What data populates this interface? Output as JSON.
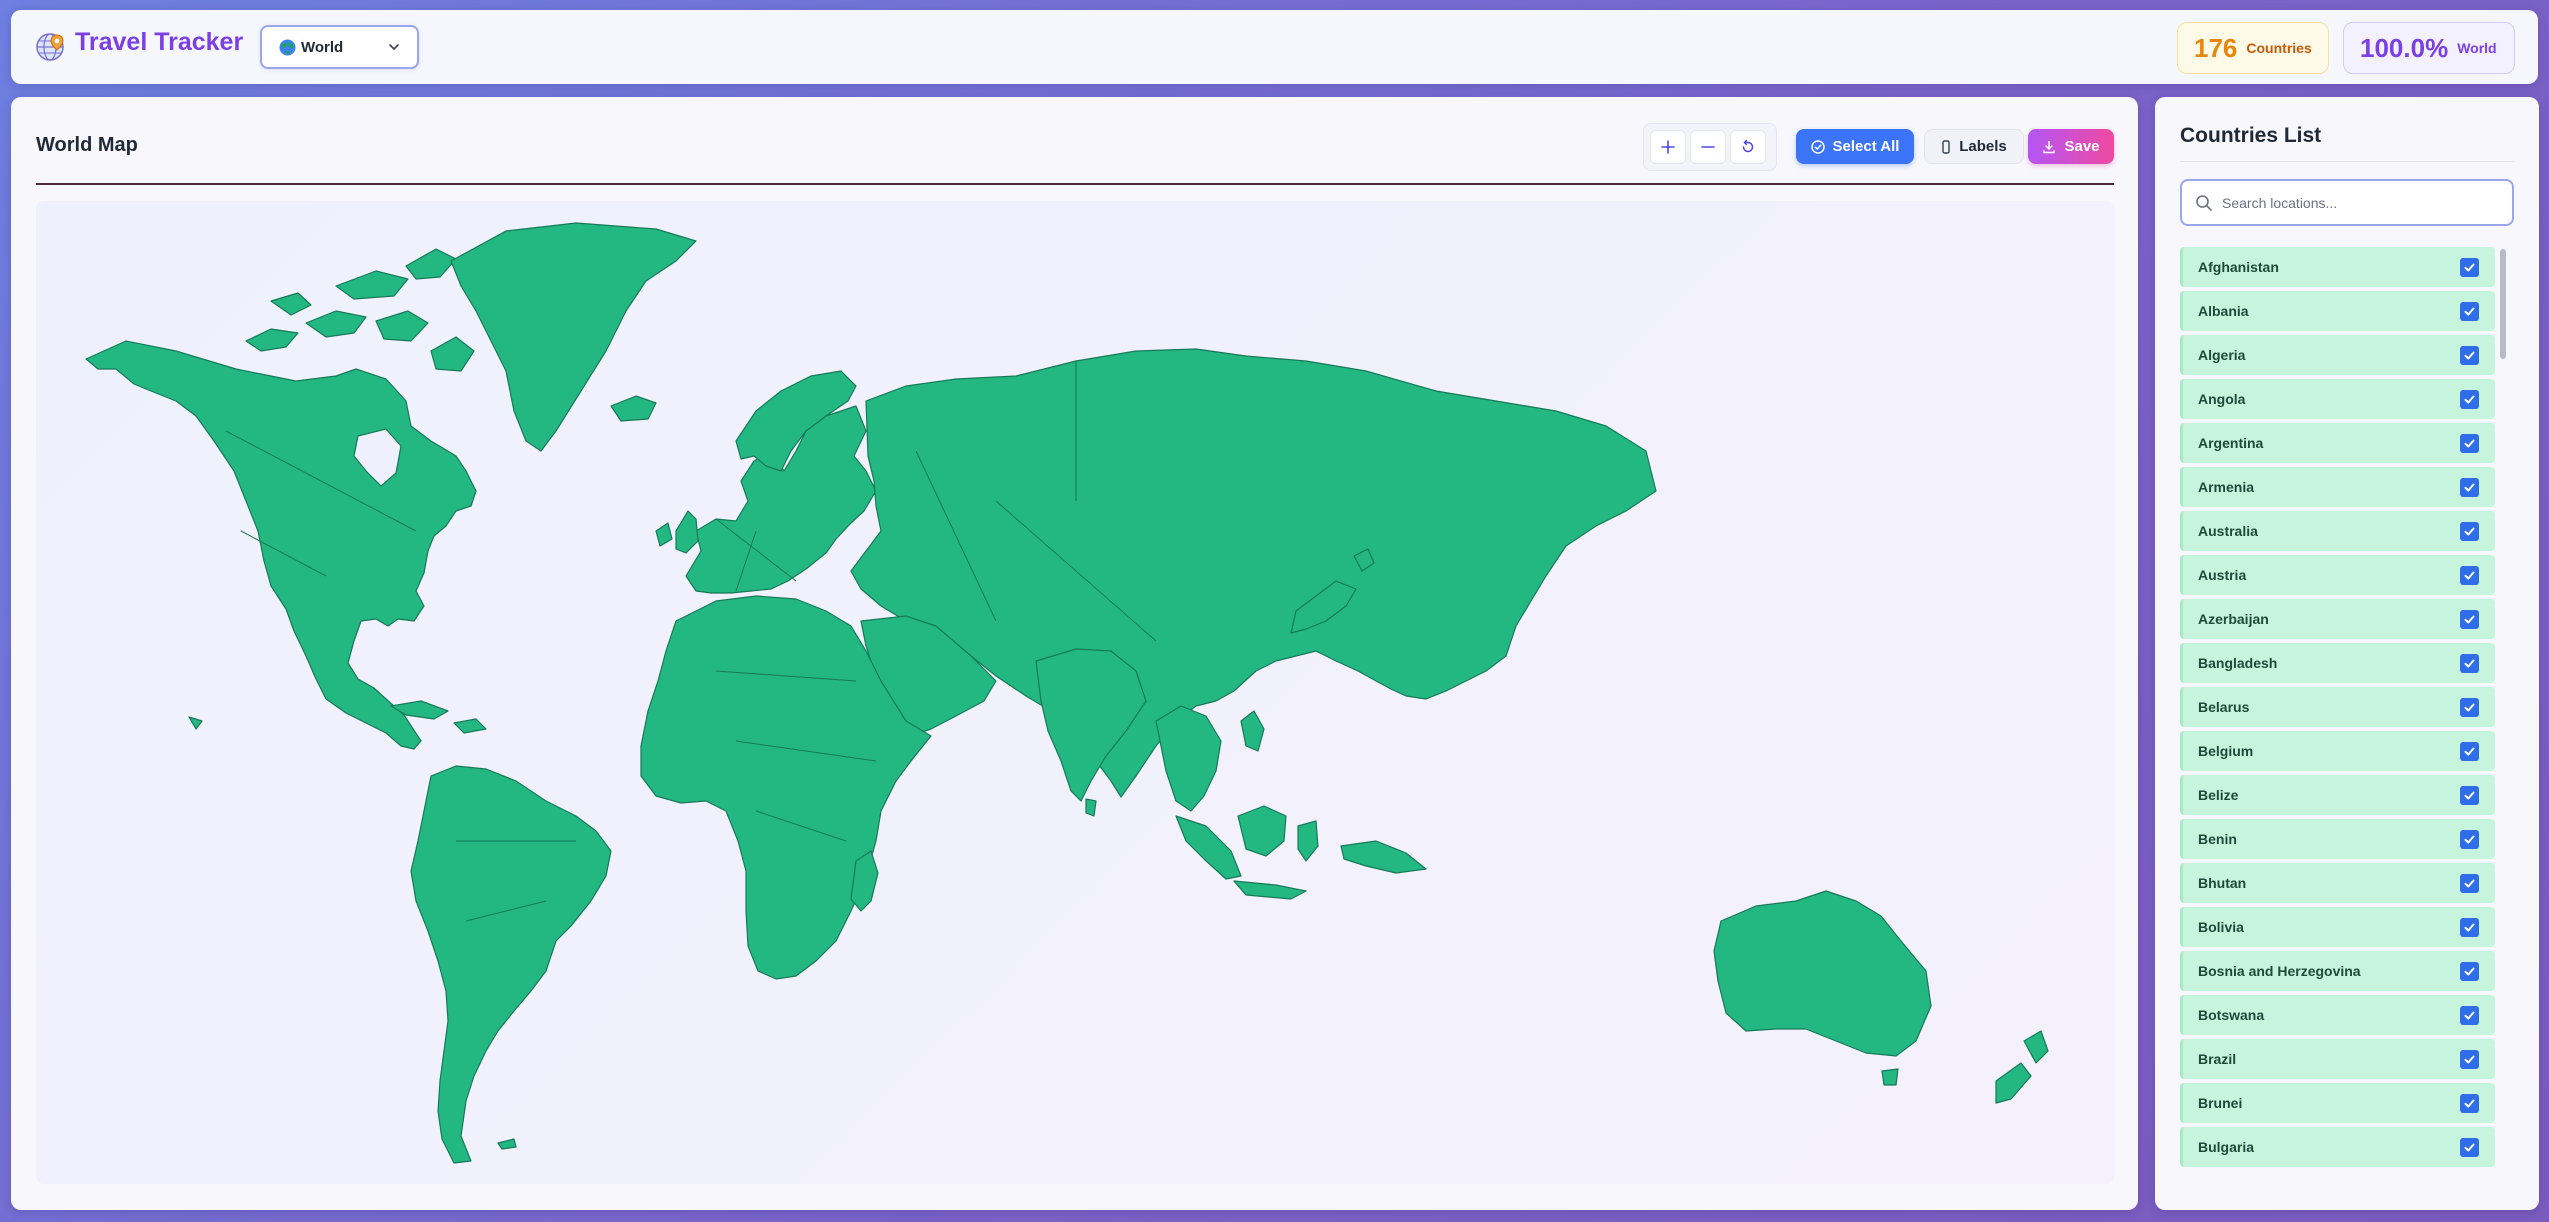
{
  "header": {
    "app_title": "Travel Tracker",
    "region_selector": {
      "selected": "World"
    },
    "stats": {
      "countries": {
        "value": "176",
        "label": "Countries"
      },
      "world": {
        "value": "100.0%",
        "label": "World"
      }
    }
  },
  "map_panel": {
    "title": "World Map",
    "toolbar": {
      "select_all_label": "Select All",
      "labels_label": "Labels",
      "save_label": "Save"
    },
    "map": {
      "land_color": "#23b782",
      "border_color": "#177a57"
    }
  },
  "sidebar": {
    "title": "Countries List",
    "search_placeholder": "Search locations...",
    "items": [
      {
        "label": "Afghanistan",
        "checked": true
      },
      {
        "label": "Albania",
        "checked": true
      },
      {
        "label": "Algeria",
        "checked": true
      },
      {
        "label": "Angola",
        "checked": true
      },
      {
        "label": "Argentina",
        "checked": true
      },
      {
        "label": "Armenia",
        "checked": true
      },
      {
        "label": "Australia",
        "checked": true
      },
      {
        "label": "Austria",
        "checked": true
      },
      {
        "label": "Azerbaijan",
        "checked": true
      },
      {
        "label": "Bangladesh",
        "checked": true
      },
      {
        "label": "Belarus",
        "checked": true
      },
      {
        "label": "Belgium",
        "checked": true
      },
      {
        "label": "Belize",
        "checked": true
      },
      {
        "label": "Benin",
        "checked": true
      },
      {
        "label": "Bhutan",
        "checked": true
      },
      {
        "label": "Bolivia",
        "checked": true
      },
      {
        "label": "Bosnia and Herzegovina",
        "checked": true
      },
      {
        "label": "Botswana",
        "checked": true
      },
      {
        "label": "Brazil",
        "checked": true
      },
      {
        "label": "Brunei",
        "checked": true
      },
      {
        "label": "Bulgaria",
        "checked": true
      }
    ]
  },
  "colors": {
    "accent": "#7b3fe4",
    "primary_button": "#3b74f6",
    "visited_row": "#c7f4dc",
    "checkbox": "#2f6ee8"
  }
}
